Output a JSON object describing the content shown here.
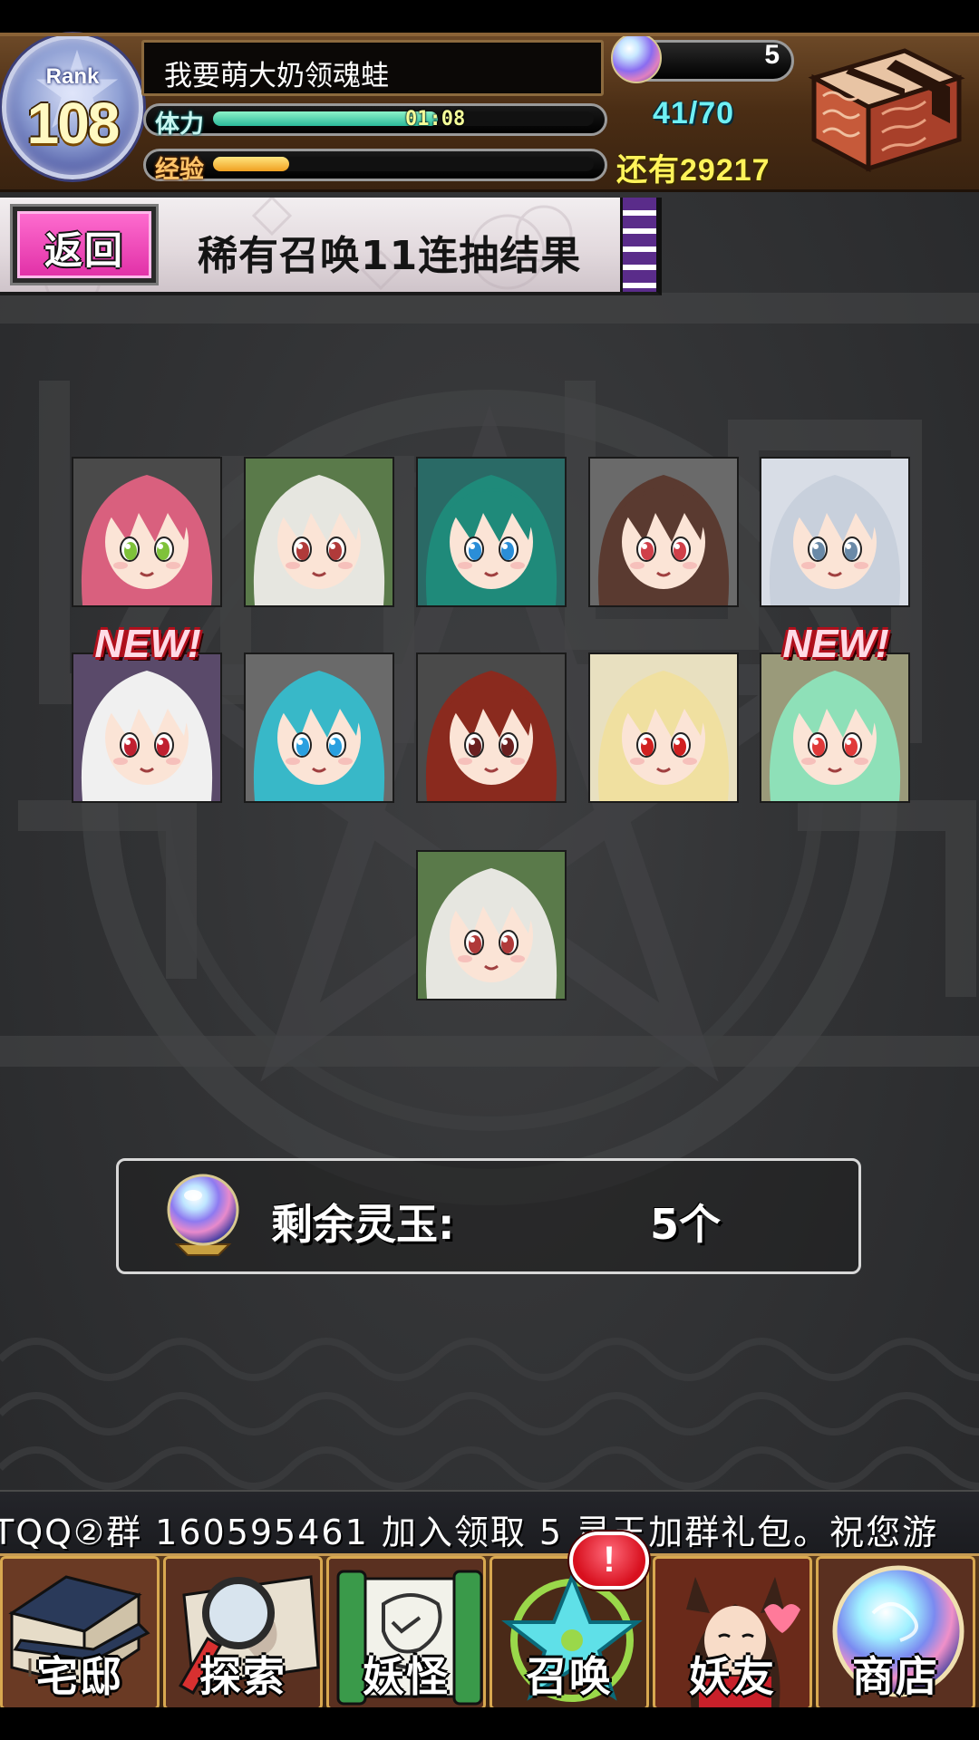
{
  "player": {
    "rank_label": "Rank",
    "rank": "108",
    "name": "我要萌大奶领魂蛙",
    "stamina_label": "体力",
    "stamina_timer": "01:08",
    "stamina_count": "41/70",
    "stamina_fraction": 0.59,
    "exp_label": "经验",
    "exp_fraction": 0.2,
    "exp_remaining": "还有29217",
    "orb_count": "5"
  },
  "banner": {
    "back_label": "返回",
    "title": "稀有召唤11连抽结果"
  },
  "results": {
    "new_label": "NEW!",
    "cards": [
      {
        "hair": "#d9607e",
        "eyes": "#7fc23a",
        "bg": "#4a4a4a",
        "new": false
      },
      {
        "hair": "#e6e6e0",
        "eyes": "#b03a3a",
        "bg": "#5a7a4a",
        "new": false
      },
      {
        "hair": "#1f8a7a",
        "eyes": "#2a8ed8",
        "bg": "#2a6a66",
        "new": false
      },
      {
        "hair": "#5a3a30",
        "eyes": "#d0404a",
        "bg": "#6a6a6a",
        "new": false
      },
      {
        "hair": "#c8d0dc",
        "eyes": "#6a8aa8",
        "bg": "#d8dde6",
        "new": false
      },
      {
        "hair": "#f0f0f0",
        "eyes": "#c02030",
        "bg": "#5a4a6a",
        "new": true
      },
      {
        "hair": "#38b8c8",
        "eyes": "#2aa0e0",
        "bg": "#6a6a6a",
        "new": false
      },
      {
        "hair": "#8a2a1e",
        "eyes": "#6a2020",
        "bg": "#4a4a4a",
        "new": false
      },
      {
        "hair": "#f0e0a0",
        "eyes": "#d02020",
        "bg": "#e8e0c0",
        "new": false
      },
      {
        "hair": "#8ee0b8",
        "eyes": "#e03a3a",
        "bg": "#9a9a7a",
        "new": true
      },
      {
        "hair": "#e6e6e0",
        "eyes": "#b03a3a",
        "bg": "#5a7a4a",
        "new": false
      }
    ]
  },
  "remaining": {
    "label": "剩余灵玉:",
    "value": "5个"
  },
  "ticker": {
    "text": "TQQ②群 160595461        加入领取 5 灵玉加群礼包。祝您游"
  },
  "nav": {
    "items": [
      {
        "label": "宅邸",
        "icon": "mansion-icon"
      },
      {
        "label": "探索",
        "icon": "magnifier-map-icon"
      },
      {
        "label": "妖怪",
        "icon": "scroll-icon"
      },
      {
        "label": "召唤",
        "icon": "pentagram-icon"
      },
      {
        "label": "妖友",
        "icon": "foxgirl-icon"
      },
      {
        "label": "商店",
        "icon": "orb-icon"
      }
    ],
    "alert": "!"
  },
  "colors": {
    "header_wood": "#4a2d14",
    "back_button_pink": "#e02fa6",
    "stamina_cyan": "#6ff0f4",
    "exp_yellow": "#fff35a",
    "new_red": "#b0101c"
  }
}
